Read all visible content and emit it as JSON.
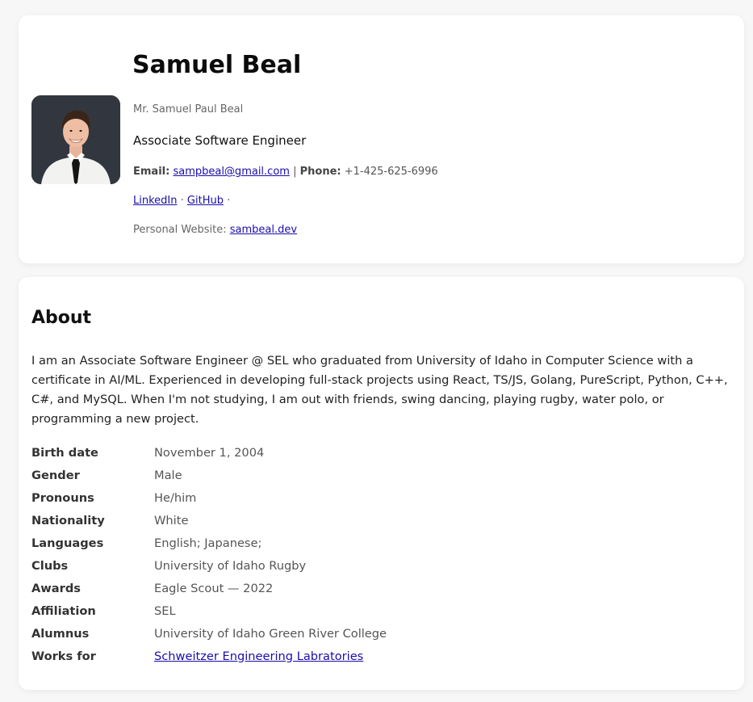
{
  "profile": {
    "name": "Samuel Beal",
    "full_name": "Mr. Samuel Paul Beal",
    "job_title": "Associate Software Engineer",
    "email_label": "Email:",
    "email": "sampbeal@gmail.com",
    "separator": "|",
    "phone_label": "Phone:",
    "phone": "+1-425-625-6996",
    "linkedin": "LinkedIn",
    "dot1": "·",
    "github": "GitHub",
    "dot2": "·",
    "website_label": "Personal Website:",
    "website": "sambeal.dev"
  },
  "about": {
    "heading": "About",
    "text": "I am an Associate Software Engineer @ SEL who graduated from University of Idaho in Computer Science with a certificate in AI/ML. Experienced in developing full-stack projects using React, TS/JS, Golang, PureScript, Python, C++, C#, and MySQL. When I'm not studying, I am out with friends, swing dancing, playing rugby, water polo, or programming a new project.",
    "facts": [
      {
        "label": "Birth date",
        "value": "November 1, 2004"
      },
      {
        "label": "Gender",
        "value": "Male"
      },
      {
        "label": "Pronouns",
        "value": "He/him"
      },
      {
        "label": "Nationality",
        "value": "White"
      },
      {
        "label": "Languages",
        "value": "English; Japanese;"
      },
      {
        "label": "Clubs",
        "value": "University of Idaho Rugby"
      },
      {
        "label": "Awards",
        "value": "Eagle Scout — 2022"
      },
      {
        "label": "Affiliation",
        "value": "SEL"
      },
      {
        "label": "Alumnus",
        "value": "University of Idaho Green River College"
      },
      {
        "label": "Works for",
        "value": "Schweitzer Engineering Labratories"
      }
    ]
  },
  "colors": {
    "link": "#1a0dab",
    "card_background": "#ffffff",
    "page_background": "#f7f7f7"
  }
}
